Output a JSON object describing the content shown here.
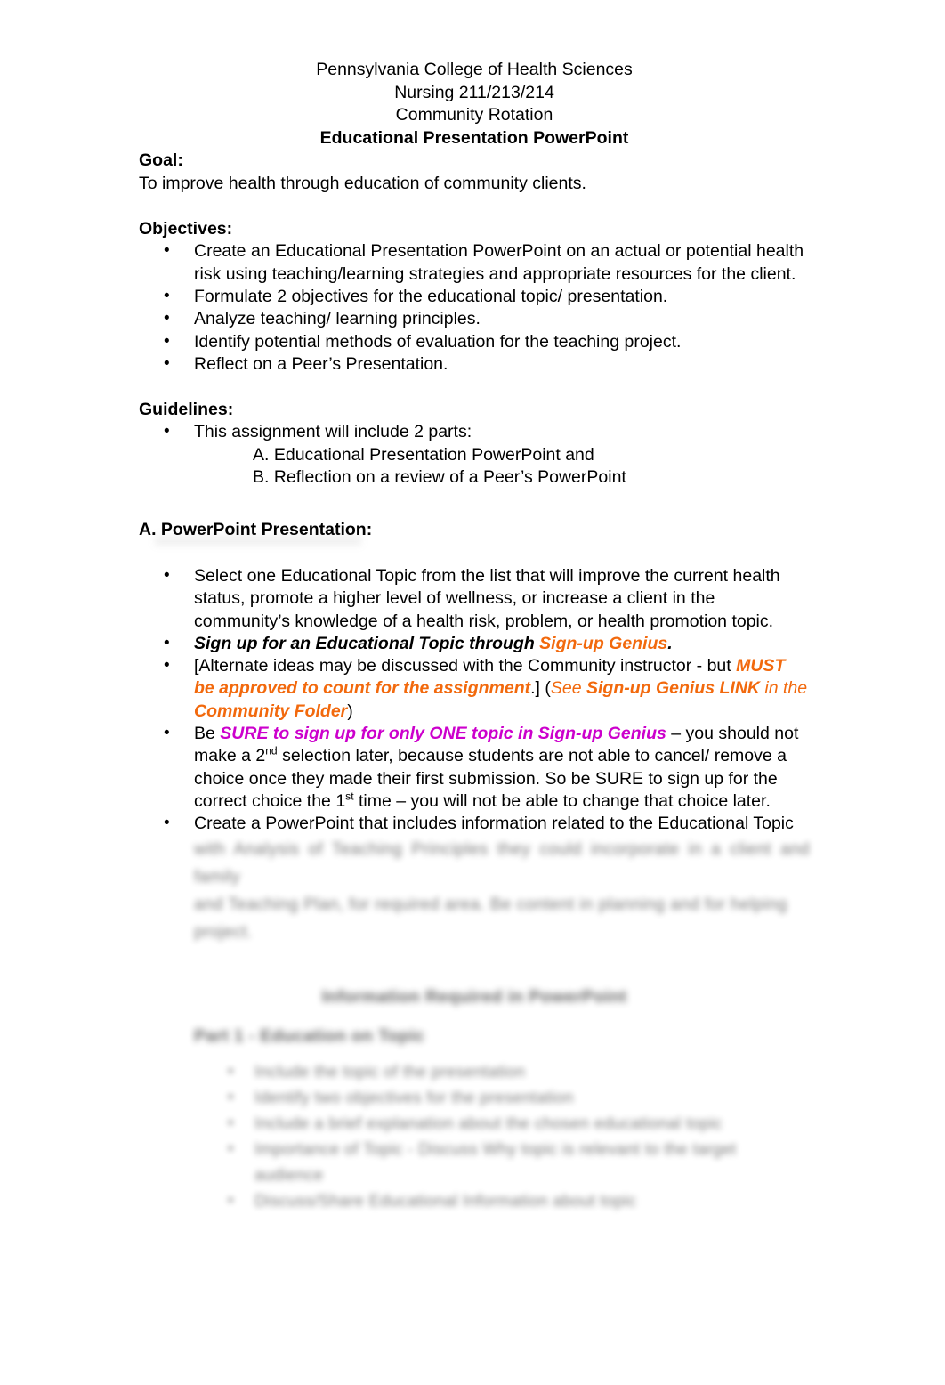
{
  "document": {
    "header": {
      "line1": "Pennsylvania College of Health Sciences",
      "line2": "Nursing 211/213/214",
      "line3": "Community Rotation",
      "line4": "Educational Presentation PowerPoint"
    },
    "goal": {
      "heading": "Goal:",
      "text": "To improve health through education of community clients."
    },
    "objectives": {
      "heading": "Objectives:",
      "items": [
        "Create an Educational Presentation PowerPoint on an actual or potential health risk using teaching/learning strategies and appropriate resources for the client.",
        "Formulate 2 objectives for the educational topic/ presentation.",
        "Analyze teaching/ learning principles.",
        "Identify potential methods of evaluation for the teaching project.",
        "Reflect on a Peer’s Presentation."
      ]
    },
    "guidelines": {
      "heading": "Guidelines:",
      "intro": "This assignment will include 2 parts:",
      "parts": [
        "A. Educational Presentation PowerPoint and",
        "B. Reflection on a review of a Peer’s PowerPoint"
      ]
    },
    "part_a": {
      "heading": "A. PowerPoint Presentation:",
      "bullet1": "Select one Educational Topic from the list that will improve the current health status, promote a higher level of wellness, or increase a client in the community’s knowledge of a health risk, problem, or health promotion topic.",
      "bullet2": {
        "lead": "Sign up for an Educational Topic through ",
        "link": "Sign-up Genius",
        "period": "."
      },
      "bullet3": {
        "part1": "[Alternate ideas may be discussed with the Community instructor - but ",
        "must": "MUST be approved to count for the assignment",
        "close": ".] (",
        "see": "See ",
        "link_label": "Sign-up Genius LINK",
        "in_the": " in the ",
        "folder": "Community Folder",
        "paren": ")"
      },
      "bullet4": {
        "be": "Be ",
        "sure": "SURE to sign up for only ONE topic in Sign-up Genius",
        "rest_a": " – you should not make a 2",
        "sup_a": "nd",
        "rest_b": " selection later, because students are not able to cancel/ remove a choice once they made their first submission. So be SURE to sign up for the correct choice the 1",
        "sup_b": "st",
        "rest_c": " time – you will not be able to change that choice later."
      },
      "bullet5": "Create a PowerPoint that includes information related to the Educational Topic"
    },
    "redacted": {
      "note": "Lower portion of the page is blurred and illegible in the source image.",
      "paragraph_lines": [
        "with Analysis of Teaching Principles they could incorporate in a client and family",
        "and Teaching Plan, for required area. Be content in planning and for helping",
        "project."
      ],
      "heading": "Information Required in PowerPoint",
      "subheading": "Part 1 - Education on Topic",
      "bullets": [
        "Include the topic of the presentation",
        "Identify two objectives for the presentation",
        "Include a brief explanation about the chosen educational topic",
        "Importance of Topic - Discuss Why topic is relevant to the target audience",
        "Discuss/Share Educational Information about topic"
      ]
    }
  },
  "colors": {
    "orange": "#F2690D",
    "magenta": "#CC00CC",
    "text": "#000000",
    "background": "#FFFFFF"
  }
}
